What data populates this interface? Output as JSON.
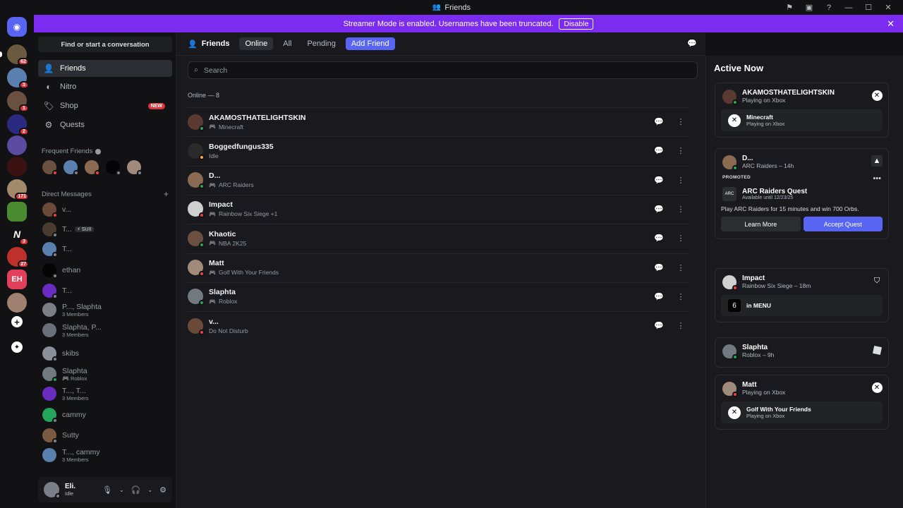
{
  "window": {
    "title": "Friends"
  },
  "banner": {
    "text": "Streamer Mode is enabled. Usernames have been truncated.",
    "button": "Disable"
  },
  "guild_badges": [
    "62",
    "3",
    "1",
    "2",
    "171",
    "3",
    "27"
  ],
  "sidebar": {
    "find_placeholder": "Find or start a conversation",
    "nav": [
      {
        "label": "Friends",
        "icon": "friends-icon"
      },
      {
        "label": "Nitro",
        "icon": "nitro-icon"
      },
      {
        "label": "Shop",
        "icon": "shop-icon",
        "badge": "NEW"
      },
      {
        "label": "Quests",
        "icon": "quests-icon"
      }
    ],
    "frequent_label": "Frequent Friends",
    "dm_label": "Direct Messages",
    "dms": [
      {
        "name": "v...",
        "sub": "",
        "status": "dnd",
        "color": "#6b4a3a"
      },
      {
        "name": "T...",
        "tag": "⚡ SUII",
        "sub": "",
        "status": "off",
        "color": "#4a3a30"
      },
      {
        "name": "T...",
        "sub": "",
        "status": "off",
        "color": "#5a80b0"
      },
      {
        "name": "ethan",
        "sub": "",
        "status": "off",
        "color": "#050505"
      },
      {
        "name": "T...",
        "sub": "",
        "status": "off",
        "color": "#6a2cc0"
      },
      {
        "name": "P..., Slaphta",
        "sub": "3 Members",
        "status": "",
        "color": "#7a7f88"
      },
      {
        "name": "Slaphta, P...",
        "sub": "3 Members",
        "status": "",
        "color": "#6a6f78"
      },
      {
        "name": "skibs",
        "sub": "",
        "status": "off",
        "color": "#8a8f98"
      },
      {
        "name": "Slaphta",
        "sub": "Roblox",
        "status": "on",
        "color": "#707a80"
      },
      {
        "name": "T..., T...",
        "sub": "3 Members",
        "status": "",
        "color": "#6a2cc0"
      },
      {
        "name": "cammy",
        "sub": "",
        "status": "off",
        "color": "#23a55a"
      },
      {
        "name": "Sutty",
        "sub": "",
        "status": "off",
        "color": "#7a5a40"
      },
      {
        "name": "T..., cammy",
        "sub": "3 Members",
        "status": "",
        "color": "#5a80b0"
      }
    ]
  },
  "user": {
    "name": "Eli.",
    "status": "Idle"
  },
  "header": {
    "title": "Friends",
    "tabs": [
      "Online",
      "All",
      "Pending"
    ],
    "add_friend": "Add Friend"
  },
  "search": {
    "placeholder": "Search"
  },
  "online_label": "Online — 8",
  "friends": [
    {
      "name": "AKAMOSTHATELIGHTSKIN",
      "activity": "Minecraft",
      "gaming": true,
      "status": "on",
      "color": "#5a3a30"
    },
    {
      "name": "Boggedfungus335",
      "activity": "Idle",
      "gaming": false,
      "status": "idle",
      "color": "#2a2a2a"
    },
    {
      "name": "D...",
      "activity": "ARC Raiders",
      "gaming": true,
      "status": "on",
      "color": "#8a6a50"
    },
    {
      "name": "Impact",
      "activity": "Rainbow Six Siege +1",
      "gaming": true,
      "status": "dnd",
      "color": "#d0d0d0"
    },
    {
      "name": "Khaotic",
      "activity": "NBA 2K25",
      "gaming": true,
      "status": "on",
      "color": "#6a5040"
    },
    {
      "name": "Matt",
      "activity": "Golf With Your Friends",
      "gaming": true,
      "status": "dnd",
      "color": "#a08a7a"
    },
    {
      "name": "Slaphta",
      "activity": "Roblox",
      "gaming": true,
      "status": "on",
      "color": "#707a80"
    },
    {
      "name": "v...",
      "activity": "Do Not Disturb",
      "gaming": false,
      "status": "dnd",
      "color": "#6b4a3a"
    }
  ],
  "active_now": {
    "title": "Active Now",
    "akamo": {
      "name": "AKAMOSTHATELIGHTSKIN",
      "sub": "Playing on Xbox",
      "game": "Minecraft",
      "game_sub": "Playing on Xbox"
    },
    "d": {
      "name": "D...",
      "sub": "ARC Raiders – 14h",
      "promo": "PROMOTED",
      "quest_title": "ARC Raiders Quest",
      "quest_sub": "Available until 12/23/25",
      "quest_desc": "Play ARC Raiders for 15 minutes and win 700 Orbs.",
      "learn": "Learn More",
      "accept": "Accept Quest"
    },
    "impact": {
      "name": "Impact",
      "sub": "Rainbow Six Siege – 18m",
      "detail": "in MENU"
    },
    "slaphta": {
      "name": "Slaphta",
      "sub": "Roblox – 9h"
    },
    "matt": {
      "name": "Matt",
      "sub": "Playing on Xbox",
      "game": "Golf With Your Friends",
      "game_sub": "Playing on Xbox"
    }
  }
}
